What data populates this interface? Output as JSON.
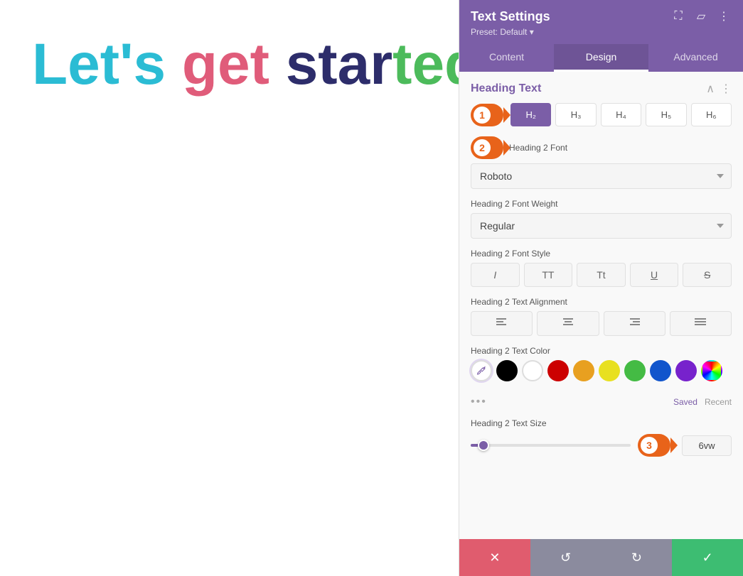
{
  "preview": {
    "word1": "Let's",
    "word2": "get",
    "word3": "star",
    "word4": "ted"
  },
  "panel": {
    "title": "Text Settings",
    "preset_label": "Preset: Default",
    "tabs": [
      {
        "id": "content",
        "label": "Content"
      },
      {
        "id": "design",
        "label": "Design",
        "active": true
      },
      {
        "id": "advanced",
        "label": "Advanced"
      }
    ],
    "section": {
      "title": "Heading Text"
    },
    "heading_levels": {
      "step_num": "1",
      "levels": [
        "H2",
        "H3",
        "H4",
        "H5",
        "H6"
      ],
      "active": "H2"
    },
    "font": {
      "label": "Heading 2 Font",
      "value": "Roboto"
    },
    "font_weight": {
      "label": "Heading 2 Font Weight",
      "value": "Regular"
    },
    "font_style": {
      "label": "Heading 2 Font Style",
      "buttons": [
        "I",
        "TT",
        "Tt",
        "U",
        "S"
      ]
    },
    "text_alignment": {
      "label": "Heading 2 Text Alignment",
      "buttons": [
        "≡",
        "≡",
        "≡",
        "≡"
      ]
    },
    "text_color": {
      "label": "Heading 2 Text Color",
      "swatches": [
        {
          "color": "eyedropper",
          "label": "eyedropper"
        },
        {
          "color": "#000000",
          "label": "black"
        },
        {
          "color": "#ffffff",
          "label": "white"
        },
        {
          "color": "#cc0000",
          "label": "red"
        },
        {
          "color": "#e8a020",
          "label": "orange"
        },
        {
          "color": "#e8e020",
          "label": "yellow"
        },
        {
          "color": "#44bb44",
          "label": "green"
        },
        {
          "color": "#1155cc",
          "label": "blue"
        },
        {
          "color": "#7722cc",
          "label": "purple"
        },
        {
          "color": "rainbow",
          "label": "custom"
        }
      ],
      "saved": "Saved",
      "recent": "Recent"
    },
    "text_size": {
      "label": "Heading 2 Text Size",
      "step_num": "3",
      "value": "6vw",
      "slider_percent": 8
    },
    "footer": {
      "cancel_icon": "✕",
      "undo_icon": "↺",
      "redo_icon": "↻",
      "confirm_icon": "✓"
    }
  }
}
